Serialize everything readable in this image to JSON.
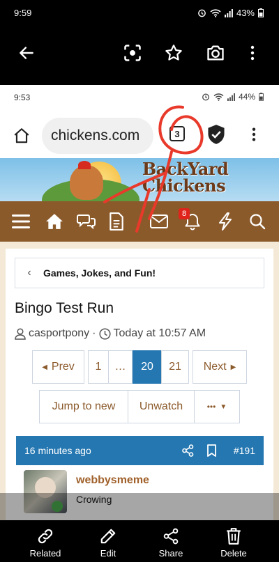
{
  "outer_status": {
    "time": "9:59",
    "battery": "43%"
  },
  "viewer_toolbar": {
    "back_icon": "arrow-left-icon",
    "lens_icon": "scan-icon",
    "star_icon": "star-icon",
    "camera_icon": "camera-icon",
    "more_icon": "kebab-icon"
  },
  "inner_status": {
    "time": "9:53",
    "battery": "44%"
  },
  "browser": {
    "url": "chickens.com",
    "tab_count": "3"
  },
  "site": {
    "logo_line1": "BackYard",
    "logo_line2": "Chickens",
    "notification_count": "8"
  },
  "breadcrumb": {
    "label": "Games, Jokes, and Fun!"
  },
  "thread": {
    "title": "Bingo Test Run",
    "author": "casportpony",
    "sep": "·",
    "time": "Today at 10:57 AM"
  },
  "pagination": {
    "prev": "Prev",
    "first": "1",
    "ellipsis": "…",
    "current": "20",
    "last": "21",
    "next": "Next"
  },
  "actions": {
    "jump": "Jump to new",
    "unwatch": "Unwatch",
    "more": "•••"
  },
  "post": {
    "ago": "16 minutes ago",
    "number": "#191",
    "username": "webbysmeme",
    "user_title": "Crowing"
  },
  "bottom_bar": {
    "related": "Related",
    "edit": "Edit",
    "share": "Share",
    "delete": "Delete"
  },
  "colors": {
    "brand_brown": "#8b5a2b",
    "post_blue": "#2577b1",
    "annotation_red": "#e8392a"
  }
}
